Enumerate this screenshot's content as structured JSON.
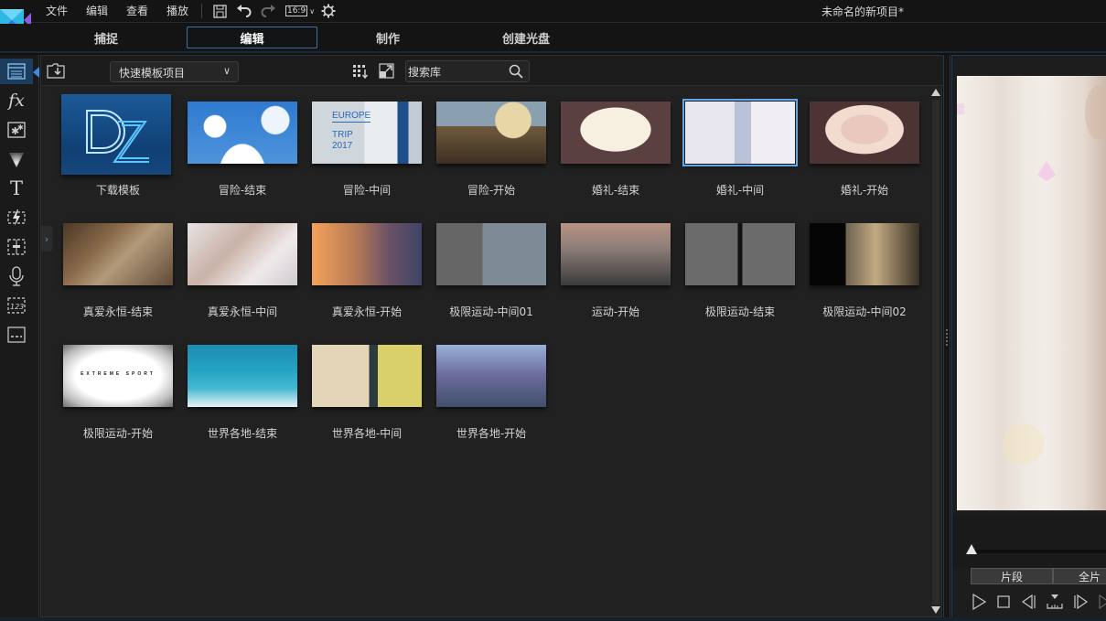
{
  "app": {
    "project_title": "未命名的新项目*",
    "aspect_ratio": "16:9"
  },
  "menu": {
    "items": [
      {
        "label": "文件"
      },
      {
        "label": "编辑"
      },
      {
        "label": "查看"
      },
      {
        "label": "播放"
      }
    ],
    "toolbar_icons": [
      "save-icon",
      "undo-icon",
      "redo-icon",
      "aspect-ratio-icon",
      "settings-icon"
    ]
  },
  "modes": {
    "tabs": [
      {
        "label": "捕捉",
        "active": false
      },
      {
        "label": "编辑",
        "active": true
      },
      {
        "label": "制作",
        "active": false
      },
      {
        "label": "创建光盘",
        "active": false
      }
    ]
  },
  "rail": {
    "items": [
      {
        "name": "media-room",
        "icon": "clapperboard-icon",
        "active": true
      },
      {
        "name": "fx-room",
        "icon": "fx-icon"
      },
      {
        "name": "pip-room",
        "icon": "pip-objects-icon"
      },
      {
        "name": "particle-room",
        "icon": "particle-icon"
      },
      {
        "name": "title-room",
        "icon": "title-t-icon"
      },
      {
        "name": "transition-room",
        "icon": "transition-icon"
      },
      {
        "name": "audio-mixing-room",
        "icon": "audio-mixing-icon"
      },
      {
        "name": "voice-over-room",
        "icon": "microphone-icon"
      },
      {
        "name": "chapter-room",
        "icon": "chapter-123-icon"
      },
      {
        "name": "subtitle-room",
        "icon": "subtitle-icon"
      }
    ]
  },
  "library": {
    "dropdown_value": "快速模板项目",
    "search_placeholder": "搜索库",
    "templates": [
      {
        "label": "下载模板",
        "selected": false
      },
      {
        "label": "冒险-结束",
        "selected": false
      },
      {
        "label": "冒险-中间",
        "selected": false,
        "thumb_text": [
          "EUROPE",
          "TRIP",
          "2017"
        ]
      },
      {
        "label": "冒险-开始",
        "selected": false
      },
      {
        "label": "婚礼-结束",
        "selected": false
      },
      {
        "label": "婚礼-中间",
        "selected": true
      },
      {
        "label": "婚礼-开始",
        "selected": false
      },
      {
        "label": "真爱永恒-结束",
        "selected": false
      },
      {
        "label": "真爱永恒-中间",
        "selected": false
      },
      {
        "label": "真爱永恒-开始",
        "selected": false
      },
      {
        "label": "极限运动-中间01",
        "selected": false
      },
      {
        "label": "运动-开始",
        "selected": false
      },
      {
        "label": "极限运动-结束",
        "selected": false
      },
      {
        "label": "极限运动-中间02",
        "selected": false
      },
      {
        "label": "极限运动-开始",
        "selected": false,
        "thumb_text": [
          "EXTREME SPORT"
        ]
      },
      {
        "label": "世界各地-结束",
        "selected": false
      },
      {
        "label": "世界各地-中间",
        "selected": false
      },
      {
        "label": "世界各地-开始",
        "selected": false
      }
    ]
  },
  "preview": {
    "segment_buttons": [
      {
        "label": "片段"
      },
      {
        "label": "全片"
      }
    ],
    "controls": [
      "play-icon",
      "stop-icon",
      "previous-frame-icon",
      "take-snapshot-icon",
      "next-frame-icon"
    ]
  },
  "colors": {
    "accent": "#3a8ee0",
    "selection": "#5fa8ee",
    "rail_active_bg": "#1d3d5c"
  }
}
